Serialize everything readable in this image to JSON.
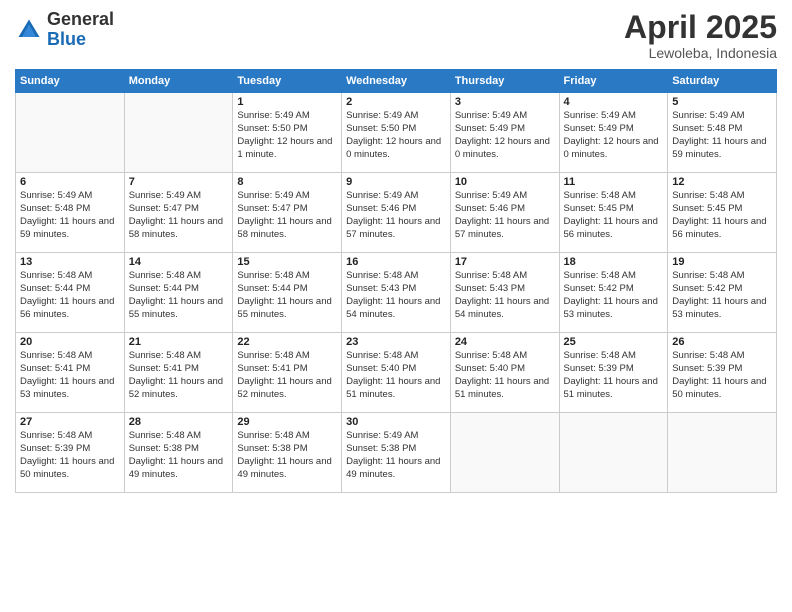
{
  "logo": {
    "general": "General",
    "blue": "Blue"
  },
  "header": {
    "month": "April 2025",
    "location": "Lewoleba, Indonesia"
  },
  "days_of_week": [
    "Sunday",
    "Monday",
    "Tuesday",
    "Wednesday",
    "Thursday",
    "Friday",
    "Saturday"
  ],
  "weeks": [
    [
      null,
      null,
      {
        "day": "1",
        "sunrise": "Sunrise: 5:49 AM",
        "sunset": "Sunset: 5:50 PM",
        "daylight": "Daylight: 12 hours and 1 minute."
      },
      {
        "day": "2",
        "sunrise": "Sunrise: 5:49 AM",
        "sunset": "Sunset: 5:50 PM",
        "daylight": "Daylight: 12 hours and 0 minutes."
      },
      {
        "day": "3",
        "sunrise": "Sunrise: 5:49 AM",
        "sunset": "Sunset: 5:49 PM",
        "daylight": "Daylight: 12 hours and 0 minutes."
      },
      {
        "day": "4",
        "sunrise": "Sunrise: 5:49 AM",
        "sunset": "Sunset: 5:49 PM",
        "daylight": "Daylight: 12 hours and 0 minutes."
      },
      {
        "day": "5",
        "sunrise": "Sunrise: 5:49 AM",
        "sunset": "Sunset: 5:48 PM",
        "daylight": "Daylight: 11 hours and 59 minutes."
      }
    ],
    [
      {
        "day": "6",
        "sunrise": "Sunrise: 5:49 AM",
        "sunset": "Sunset: 5:48 PM",
        "daylight": "Daylight: 11 hours and 59 minutes."
      },
      {
        "day": "7",
        "sunrise": "Sunrise: 5:49 AM",
        "sunset": "Sunset: 5:47 PM",
        "daylight": "Daylight: 11 hours and 58 minutes."
      },
      {
        "day": "8",
        "sunrise": "Sunrise: 5:49 AM",
        "sunset": "Sunset: 5:47 PM",
        "daylight": "Daylight: 11 hours and 58 minutes."
      },
      {
        "day": "9",
        "sunrise": "Sunrise: 5:49 AM",
        "sunset": "Sunset: 5:46 PM",
        "daylight": "Daylight: 11 hours and 57 minutes."
      },
      {
        "day": "10",
        "sunrise": "Sunrise: 5:49 AM",
        "sunset": "Sunset: 5:46 PM",
        "daylight": "Daylight: 11 hours and 57 minutes."
      },
      {
        "day": "11",
        "sunrise": "Sunrise: 5:48 AM",
        "sunset": "Sunset: 5:45 PM",
        "daylight": "Daylight: 11 hours and 56 minutes."
      },
      {
        "day": "12",
        "sunrise": "Sunrise: 5:48 AM",
        "sunset": "Sunset: 5:45 PM",
        "daylight": "Daylight: 11 hours and 56 minutes."
      }
    ],
    [
      {
        "day": "13",
        "sunrise": "Sunrise: 5:48 AM",
        "sunset": "Sunset: 5:44 PM",
        "daylight": "Daylight: 11 hours and 56 minutes."
      },
      {
        "day": "14",
        "sunrise": "Sunrise: 5:48 AM",
        "sunset": "Sunset: 5:44 PM",
        "daylight": "Daylight: 11 hours and 55 minutes."
      },
      {
        "day": "15",
        "sunrise": "Sunrise: 5:48 AM",
        "sunset": "Sunset: 5:44 PM",
        "daylight": "Daylight: 11 hours and 55 minutes."
      },
      {
        "day": "16",
        "sunrise": "Sunrise: 5:48 AM",
        "sunset": "Sunset: 5:43 PM",
        "daylight": "Daylight: 11 hours and 54 minutes."
      },
      {
        "day": "17",
        "sunrise": "Sunrise: 5:48 AM",
        "sunset": "Sunset: 5:43 PM",
        "daylight": "Daylight: 11 hours and 54 minutes."
      },
      {
        "day": "18",
        "sunrise": "Sunrise: 5:48 AM",
        "sunset": "Sunset: 5:42 PM",
        "daylight": "Daylight: 11 hours and 53 minutes."
      },
      {
        "day": "19",
        "sunrise": "Sunrise: 5:48 AM",
        "sunset": "Sunset: 5:42 PM",
        "daylight": "Daylight: 11 hours and 53 minutes."
      }
    ],
    [
      {
        "day": "20",
        "sunrise": "Sunrise: 5:48 AM",
        "sunset": "Sunset: 5:41 PM",
        "daylight": "Daylight: 11 hours and 53 minutes."
      },
      {
        "day": "21",
        "sunrise": "Sunrise: 5:48 AM",
        "sunset": "Sunset: 5:41 PM",
        "daylight": "Daylight: 11 hours and 52 minutes."
      },
      {
        "day": "22",
        "sunrise": "Sunrise: 5:48 AM",
        "sunset": "Sunset: 5:41 PM",
        "daylight": "Daylight: 11 hours and 52 minutes."
      },
      {
        "day": "23",
        "sunrise": "Sunrise: 5:48 AM",
        "sunset": "Sunset: 5:40 PM",
        "daylight": "Daylight: 11 hours and 51 minutes."
      },
      {
        "day": "24",
        "sunrise": "Sunrise: 5:48 AM",
        "sunset": "Sunset: 5:40 PM",
        "daylight": "Daylight: 11 hours and 51 minutes."
      },
      {
        "day": "25",
        "sunrise": "Sunrise: 5:48 AM",
        "sunset": "Sunset: 5:39 PM",
        "daylight": "Daylight: 11 hours and 51 minutes."
      },
      {
        "day": "26",
        "sunrise": "Sunrise: 5:48 AM",
        "sunset": "Sunset: 5:39 PM",
        "daylight": "Daylight: 11 hours and 50 minutes."
      }
    ],
    [
      {
        "day": "27",
        "sunrise": "Sunrise: 5:48 AM",
        "sunset": "Sunset: 5:39 PM",
        "daylight": "Daylight: 11 hours and 50 minutes."
      },
      {
        "day": "28",
        "sunrise": "Sunrise: 5:48 AM",
        "sunset": "Sunset: 5:38 PM",
        "daylight": "Daylight: 11 hours and 49 minutes."
      },
      {
        "day": "29",
        "sunrise": "Sunrise: 5:48 AM",
        "sunset": "Sunset: 5:38 PM",
        "daylight": "Daylight: 11 hours and 49 minutes."
      },
      {
        "day": "30",
        "sunrise": "Sunrise: 5:49 AM",
        "sunset": "Sunset: 5:38 PM",
        "daylight": "Daylight: 11 hours and 49 minutes."
      },
      null,
      null,
      null
    ]
  ]
}
